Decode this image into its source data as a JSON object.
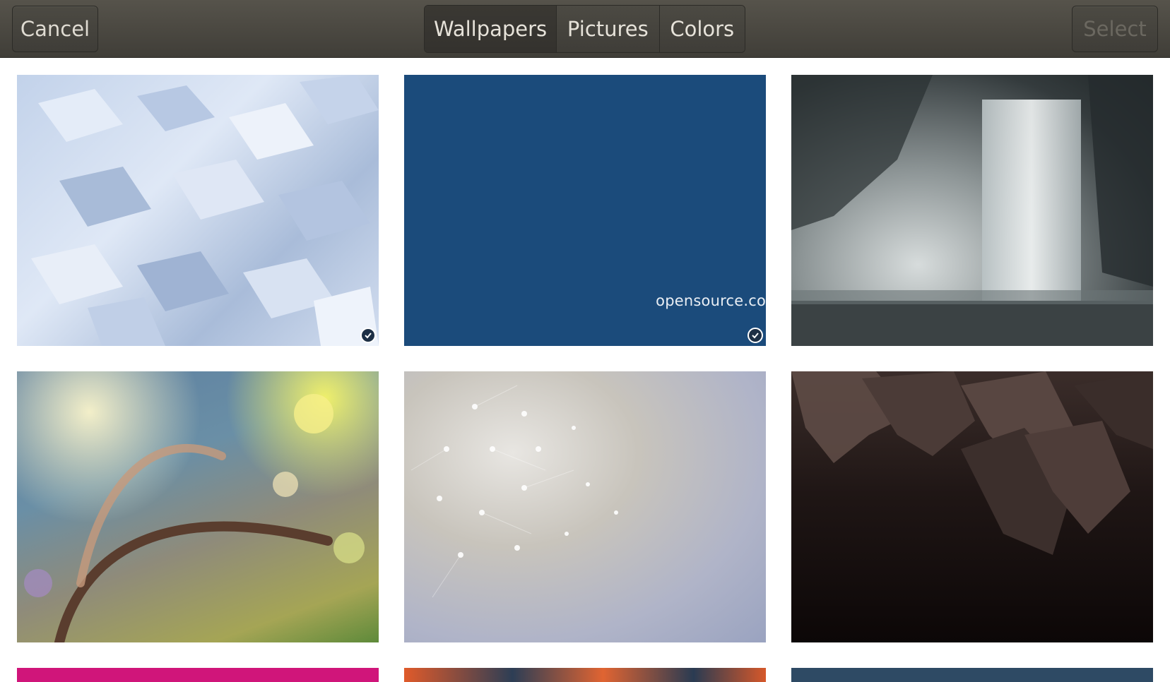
{
  "header": {
    "cancel_label": "Cancel",
    "select_label": "Select",
    "tabs": [
      {
        "label": "Wallpapers",
        "active": true
      },
      {
        "label": "Pictures",
        "active": false
      },
      {
        "label": "Colors",
        "active": false
      }
    ]
  },
  "grid": {
    "items": [
      {
        "name": "geometric-cubes",
        "selected_indicator": true
      },
      {
        "name": "opensource-blue",
        "watermark": "opensource.co",
        "selected_indicator": true
      },
      {
        "name": "waterfall",
        "selected_indicator": false
      },
      {
        "name": "grass-bokeh",
        "selected_indicator": false
      },
      {
        "name": "dandelion",
        "selected_indicator": false
      },
      {
        "name": "dark-leaves",
        "selected_indicator": false
      },
      {
        "name": "magenta",
        "selected_indicator": false
      },
      {
        "name": "orange-flowers",
        "selected_indicator": false
      },
      {
        "name": "dark-blue",
        "selected_indicator": false
      }
    ]
  },
  "colors": {
    "headerbar": "#47453f",
    "opensource_blue": "#1b4b7b"
  }
}
